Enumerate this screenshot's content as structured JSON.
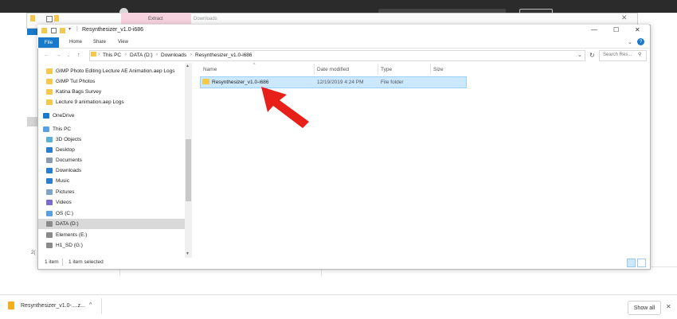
{
  "background_window": {
    "extract_tab": "Extract",
    "downloads_tab": "Downloads"
  },
  "window": {
    "title": "Resynthesizer_v1.0-i686",
    "controls": {
      "minimize": "—",
      "maximize": "☐",
      "close": "✕"
    }
  },
  "ribbon": {
    "tabs": [
      "File",
      "Home",
      "Share",
      "View"
    ],
    "help": "?"
  },
  "address_bar": {
    "crumbs": [
      "This PC",
      "DATA (D:)",
      "Downloads",
      "Resynthesizer_v1.0-i686"
    ]
  },
  "search": {
    "placeholder": "Search Res..."
  },
  "nav_pane": {
    "items": [
      {
        "label": "GIMP Photo Editing Lecture AE Animation.aep Logs",
        "icon": "folder-icon",
        "color": "#f2c94c"
      },
      {
        "label": "GIMP Tut Photos",
        "icon": "folder-icon",
        "color": "#f2c94c"
      },
      {
        "label": "Katina Bags Survey",
        "icon": "folder-icon",
        "color": "#f2c94c"
      },
      {
        "label": "Lecture 9 animation.aep Logs",
        "icon": "folder-icon",
        "color": "#f2c94c"
      },
      {
        "label": "OneDrive",
        "icon": "cloud-icon",
        "color": "#1979ca"
      },
      {
        "label": "This PC",
        "icon": "computer-icon",
        "color": "#5aa0e0"
      },
      {
        "label": "3D Objects",
        "icon": "cube-icon",
        "color": "#5ab0d8"
      },
      {
        "label": "Desktop",
        "icon": "desktop-icon",
        "color": "#2a7dd1"
      },
      {
        "label": "Documents",
        "icon": "document-icon",
        "color": "#8a9bb0"
      },
      {
        "label": "Downloads",
        "icon": "download-icon",
        "color": "#2a7dd1"
      },
      {
        "label": "Music",
        "icon": "music-icon",
        "color": "#2a7dd1"
      },
      {
        "label": "Pictures",
        "icon": "pictures-icon",
        "color": "#7aa5c8"
      },
      {
        "label": "Videos",
        "icon": "video-icon",
        "color": "#7a6cc8"
      },
      {
        "label": "OS (C:)",
        "icon": "drive-icon",
        "color": "#5aa0e0"
      },
      {
        "label": "DATA (D:)",
        "icon": "drive-icon",
        "color": "#8a8a8a"
      },
      {
        "label": "Elements (E:)",
        "icon": "drive-icon",
        "color": "#8a8a8a"
      },
      {
        "label": "H1_SD (G:)",
        "icon": "drive-icon",
        "color": "#8a8a8a"
      }
    ]
  },
  "columns": [
    "Name",
    "Date modified",
    "Type",
    "Size"
  ],
  "files": [
    {
      "name": "Resynthesizer_v1.0-i686",
      "date": "12/19/2019 4:24 PM",
      "type": "File folder",
      "size": ""
    }
  ],
  "status_bar": {
    "count": "1 item",
    "selected": "1 item selected"
  },
  "left_edge_text": "2(",
  "downloads_bar": {
    "file": "Resynthesizer_v1.0-....z...",
    "chevron": "^",
    "show_all": "Show all",
    "close": "✕"
  },
  "colors": {
    "accent": "#1979ca",
    "selection": "#cce8ff",
    "arrow": "#e8201a"
  }
}
